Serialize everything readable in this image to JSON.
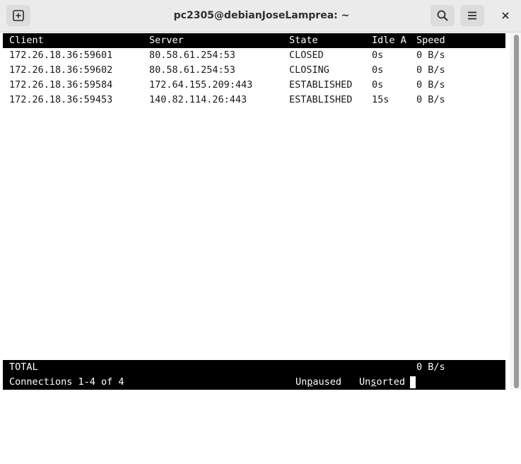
{
  "window": {
    "title": "pc2305@debianJoseLamprea: ~"
  },
  "icons": {
    "new_tab": "new-tab-icon",
    "search": "search-icon",
    "menu": "hamburger-menu-icon",
    "close": "close-icon"
  },
  "table": {
    "headers": [
      "Client",
      "Server",
      "State",
      "Idle A",
      "Speed"
    ],
    "rows": [
      [
        "172.26.18.36:59601",
        "80.58.61.254:53",
        "CLOSED",
        "0s",
        "0 B/s"
      ],
      [
        "172.26.18.36:59602",
        "80.58.61.254:53",
        "CLOSING",
        "0s",
        "0 B/s"
      ],
      [
        "172.26.18.36:59584",
        "172.64.155.209:443",
        "ESTABLISHED",
        "0s",
        "0 B/s"
      ],
      [
        "172.26.18.36:59453",
        "140.82.114.26:443",
        "ESTABLISHED",
        "15s",
        "0 B/s"
      ]
    ]
  },
  "footer": {
    "total_label": "TOTAL",
    "total_speed": "0 B/s",
    "connections": "Connections 1-4 of 4",
    "pause_state": {
      "pre": "Un",
      "hot": "p",
      "post": "aused"
    },
    "sort_state": {
      "pre": "Un",
      "hot": "s",
      "post": "orted"
    }
  }
}
